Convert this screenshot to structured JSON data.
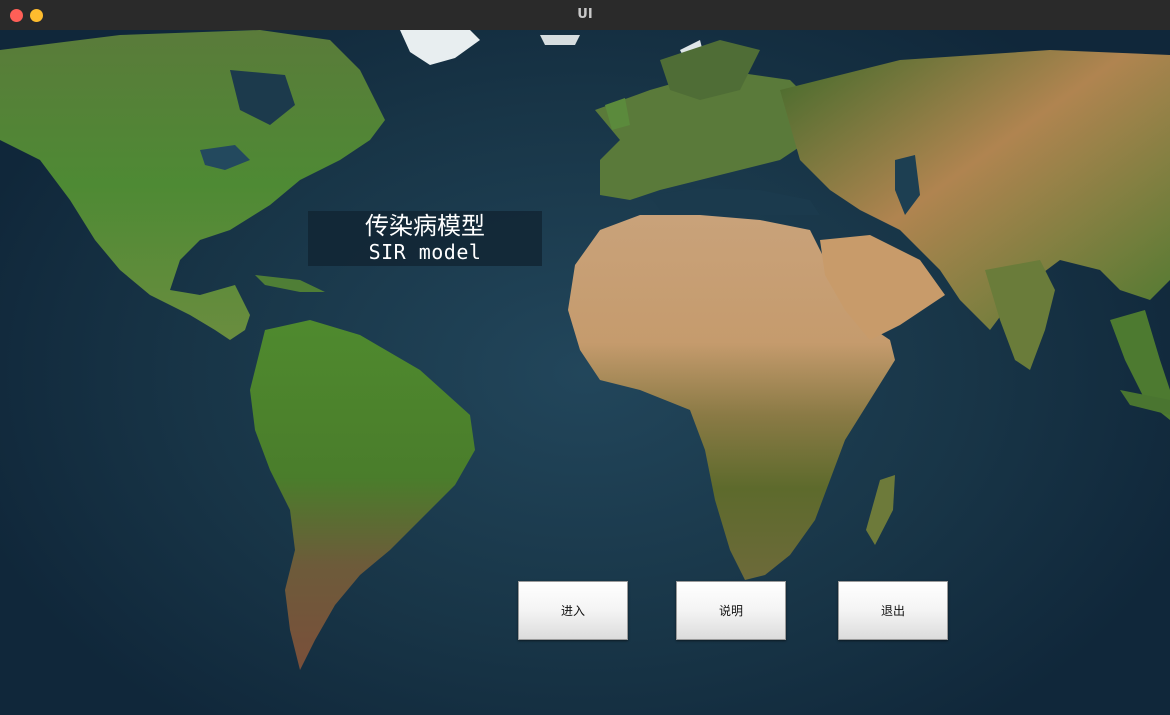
{
  "window": {
    "title": "UI"
  },
  "header": {
    "title_cn": "传染病模型",
    "title_en": "SIR model"
  },
  "buttons": {
    "enter": "进入",
    "help": "说明",
    "quit": "退出"
  },
  "colors": {
    "ocean": "#1d3446",
    "titlebar": "#2a2a2a",
    "close": "#ff5f57",
    "minimize": "#febc2e"
  }
}
